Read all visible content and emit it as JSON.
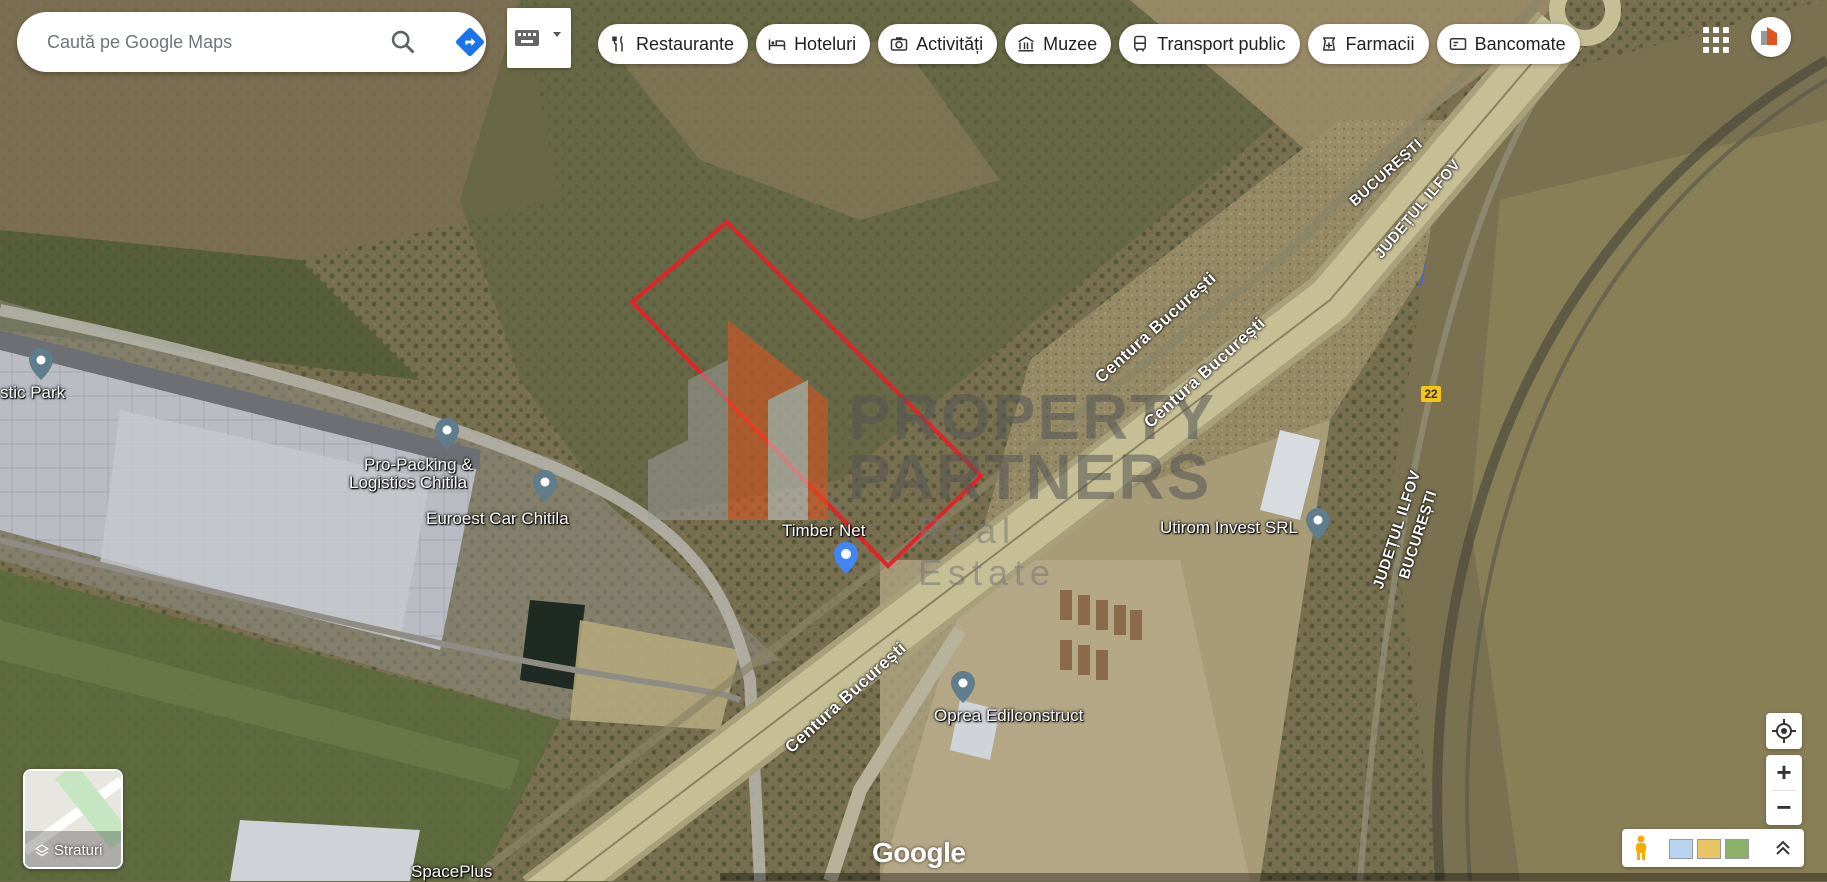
{
  "search": {
    "placeholder": "Caută pe Google Maps"
  },
  "chips": [
    {
      "label": "Restaurante",
      "icon": "fork-knife-icon"
    },
    {
      "label": "Hoteluri",
      "icon": "bed-icon"
    },
    {
      "label": "Activități",
      "icon": "camera-icon"
    },
    {
      "label": "Muzee",
      "icon": "museum-icon"
    },
    {
      "label": "Transport public",
      "icon": "bus-icon"
    },
    {
      "label": "Farmacii",
      "icon": "pharmacy-icon"
    },
    {
      "label": "Bancomate",
      "icon": "atm-icon"
    }
  ],
  "places": {
    "logistic_park": "stic Park",
    "pro_packing_1": "Pro-Packing &",
    "pro_packing_2": "Logistics Chitila",
    "euroest": "Euroest Car Chitila",
    "timber_net": "Timber Net",
    "utirom": "Utirom Invest SRL",
    "oprea": "Oprea Edilconstruct",
    "spaceplus": "SpacePlus"
  },
  "roads": {
    "centura_1": "Centura București",
    "centura_2": "Centura București",
    "centura_3": "Centura București",
    "bucuresti_top": "BUCUREȘTI",
    "judetul_ilfov_top": "JUDEȚUL ILFOV",
    "judetul_ilfov_right": "JUDEȚUL ILFOV",
    "bucuresti_right": "BUCUREȘTI",
    "route_number": "22"
  },
  "watermark": {
    "line1": "PROPERTY",
    "line2": "PARTNERS",
    "line3": "Real Estate"
  },
  "layers": {
    "label": "Straturi"
  },
  "branding": {
    "google": "Google"
  },
  "zoom": {
    "in": "+",
    "out": "−"
  }
}
